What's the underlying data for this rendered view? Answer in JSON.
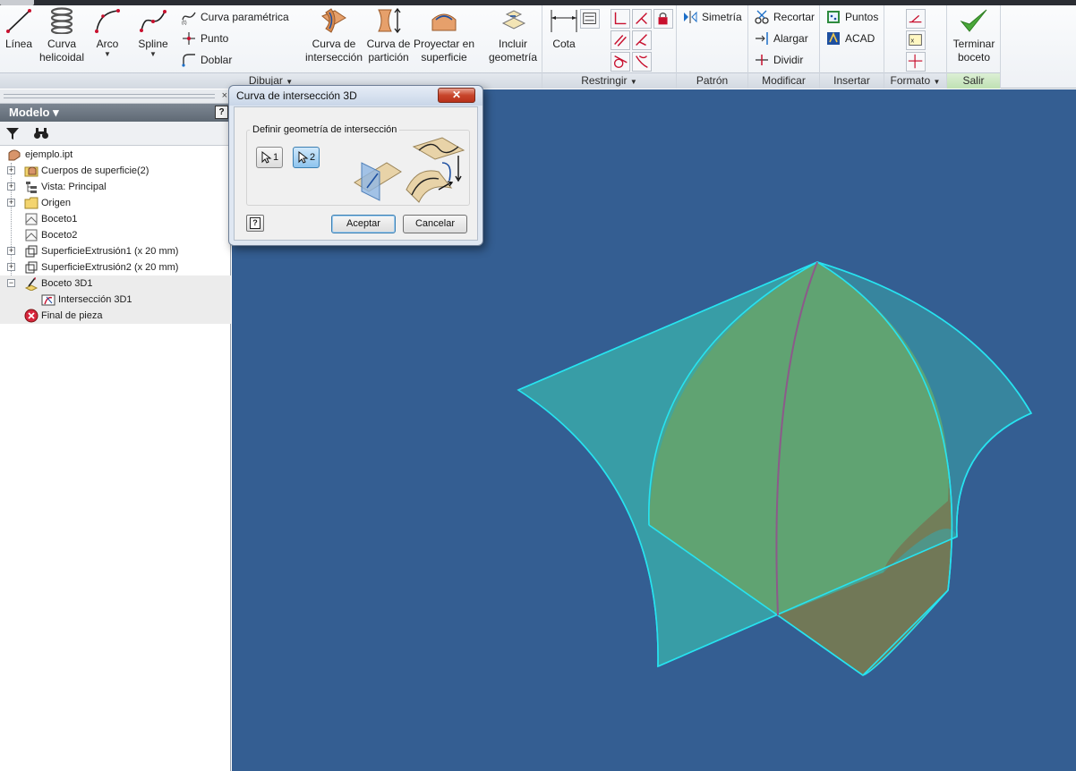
{
  "ribbon": {
    "dibujar": {
      "title": "Dibujar",
      "linea": "Línea",
      "curva_helicoidal": "Curva helicoidal",
      "arco": "Arco",
      "spline": "Spline",
      "curva_parametrica": "Curva paramétrica",
      "punto": "Punto",
      "doblar": "Doblar",
      "curva_interseccion": "Curva de intersección",
      "curva_particion": "Curva de partición",
      "proyectar_superficie": "Proyectar en superficie",
      "incluir_geometria": "Incluir geometría"
    },
    "restringir": {
      "title": "Restringir",
      "cota": "Cota"
    },
    "patron": {
      "title": "Patrón",
      "simetria": "Simetría"
    },
    "modificar": {
      "title": "Modificar",
      "recortar": "Recortar",
      "alargar": "Alargar",
      "dividir": "Dividir"
    },
    "insertar": {
      "title": "Insertar",
      "puntos": "Puntos",
      "acad": "ACAD"
    },
    "formato": {
      "title": "Formato"
    },
    "salir": {
      "title": "Salir",
      "terminar_boceto": "Terminar boceto"
    },
    "dropdown_arrow": "▼"
  },
  "browser": {
    "close": "×",
    "header": "Modelo ▾",
    "help": "?",
    "tree": [
      {
        "label": "ejemplo.ipt"
      },
      {
        "label": "Cuerpos de superficie(2)"
      },
      {
        "label": "Vista: Principal"
      },
      {
        "label": "Origen"
      },
      {
        "label": "Boceto1"
      },
      {
        "label": "Boceto2"
      },
      {
        "label": "SuperficieExtrusión1 (x 20 mm)"
      },
      {
        "label": "SuperficieExtrusión2 (x 20 mm)"
      },
      {
        "label": "Boceto 3D1"
      },
      {
        "label": "Intersección 3D1"
      },
      {
        "label": "Final de pieza"
      }
    ],
    "expander": "+",
    "collapser": "−"
  },
  "dialog": {
    "title": "Curva de intersección 3D",
    "close": "✕",
    "group_title": "Definir geometría de intersección",
    "select1": "1",
    "select2": "2",
    "help": "?",
    "accept": "Aceptar",
    "cancel": "Cancelar"
  },
  "colors": {
    "viewport_bg": "#345e92",
    "surface_edge": "#27e3f0",
    "surface_teal_fill": "#3aa5a8",
    "surface_olive_fill": "#7c7d4c",
    "surface_green_fill": "#5ea774",
    "intersection_curve": "#8c5a8a"
  }
}
